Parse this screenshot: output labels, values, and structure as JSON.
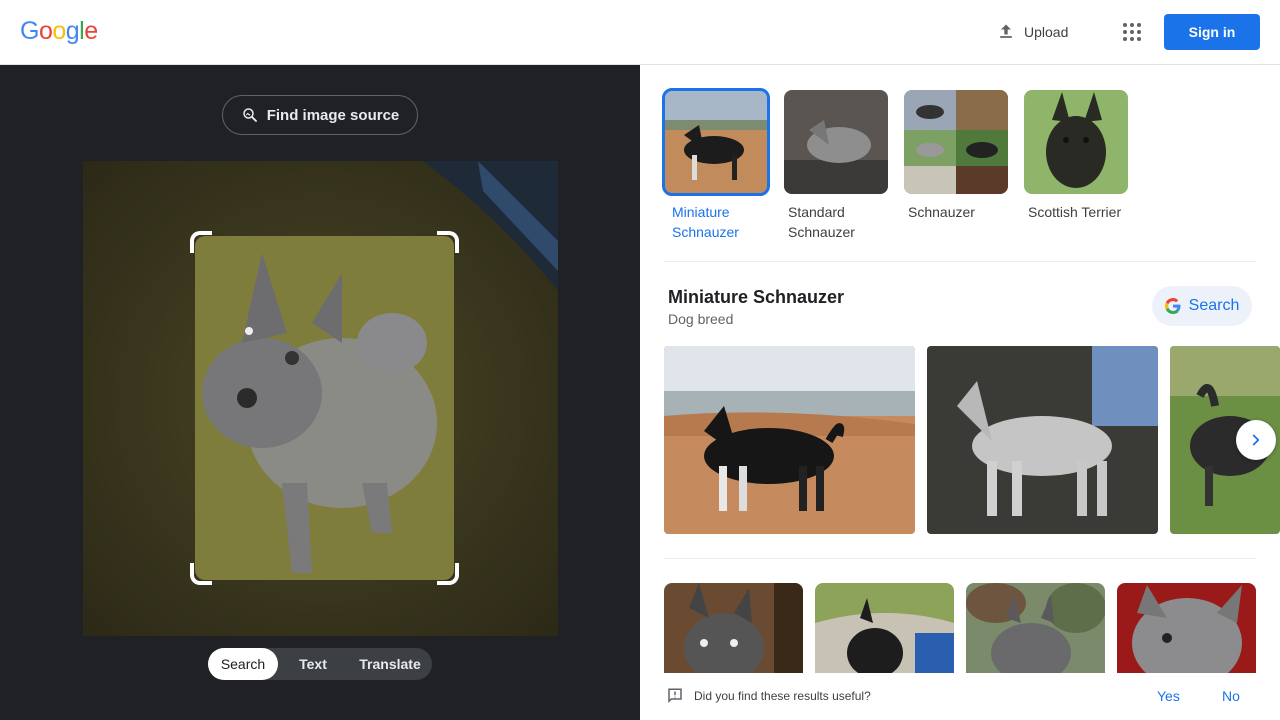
{
  "header": {
    "logo": [
      "G",
      "o",
      "o",
      "g",
      "l",
      "e"
    ],
    "logo_colors": [
      "#4285f4",
      "#ea4335",
      "#fbbc05",
      "#4285f4",
      "#34a853",
      "#ea4335"
    ],
    "upload_label": "Upload",
    "apps_icon": "apps-grid-icon",
    "signin_label": "Sign in"
  },
  "left": {
    "find_source_label": "Find image source",
    "modes": [
      "Search",
      "Text",
      "Translate"
    ],
    "active_mode": "Search"
  },
  "chips": [
    {
      "label": "Miniature Schnauzer",
      "active": true
    },
    {
      "label": "Standard Schnauzer",
      "active": false
    },
    {
      "label": "Schnauzer",
      "active": false
    },
    {
      "label": "Scottish Terrier",
      "active": false
    }
  ],
  "entity": {
    "title": "Miniature Schnauzer",
    "subtitle": "Dog breed",
    "search_label": "Search"
  },
  "feedback": {
    "question": "Did you find these results useful?",
    "yes": "Yes",
    "no": "No"
  },
  "colors": {
    "accent": "#1a73e8",
    "dark_pane": "#202124"
  }
}
